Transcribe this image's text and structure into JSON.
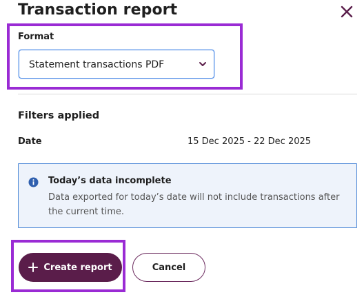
{
  "dialog": {
    "title": "Transaction report",
    "close_icon": "close-icon"
  },
  "format": {
    "label": "Format",
    "selected": "Statement transactions PDF",
    "chevron_icon": "chevron-down-icon"
  },
  "filters": {
    "heading": "Filters applied",
    "date_label": "Date",
    "date_value": "15 Dec 2025 - 22 Dec 2025"
  },
  "notice": {
    "icon": "info-icon",
    "title": "Today’s data incomplete",
    "text": "Data exported for today’s date will not include transactions after the current time."
  },
  "actions": {
    "create_label": "Create report",
    "create_icon": "plus-icon",
    "cancel_label": "Cancel"
  },
  "colors": {
    "primary": "#5a1d4a",
    "highlight": "#9a2bd4",
    "info_border": "#4a86d6",
    "info_bg": "#eef3fb",
    "focus_border": "#4d8be6"
  }
}
